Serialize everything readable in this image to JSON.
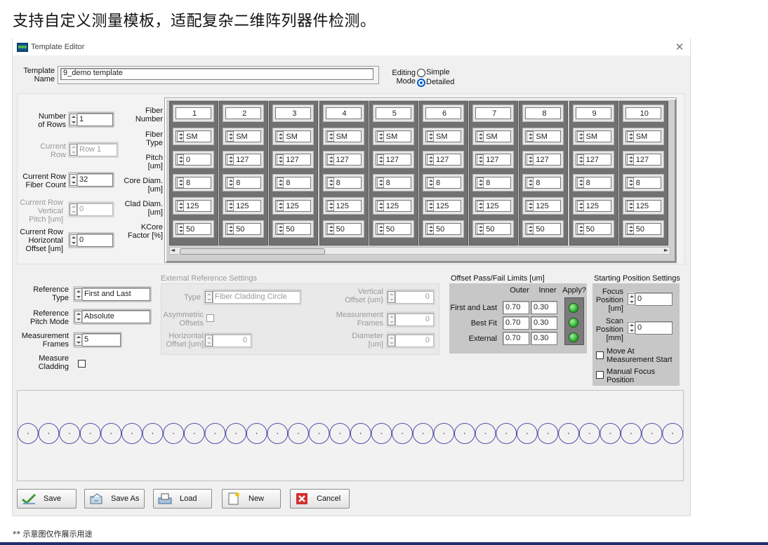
{
  "headline": "支持自定义测量模板，适配复杂二维阵列器件检测。",
  "window_title": "Template Editor",
  "close_glyph": "✕",
  "template_name": {
    "label": "Template\nName",
    "value": "9_demo template"
  },
  "editing_mode": {
    "label": "Editing\nMode",
    "options": [
      "Simple",
      "Detailed"
    ],
    "selected": "Detailed"
  },
  "left_params": {
    "number_of_rows": {
      "label": "Number\nof Rows",
      "value": "1"
    },
    "current_row": {
      "label": "Current\nRow",
      "value": "Row 1"
    },
    "current_row_fiber_count": {
      "label": "Current Row\nFiber Count",
      "value": "32"
    },
    "current_row_vertical_pitch": {
      "label": "Current Row\nVertical\nPitch [um]",
      "value": "0"
    },
    "current_row_horizontal_offset": {
      "label": "Current Row\nHorizontal\nOffset [um]",
      "value": "0"
    }
  },
  "grid": {
    "row_labels": [
      "Fiber\nNumber",
      "Fiber\nType",
      "Pitch\n[um]",
      "Core Diam.\n[um]",
      "Clad Diam.\n[um]",
      "KCore\nFactor [%]"
    ],
    "fiber_numbers": [
      "1",
      "2",
      "3",
      "4",
      "5",
      "6",
      "7",
      "8",
      "9",
      "10"
    ],
    "fiber_types": [
      "SM",
      "SM",
      "SM",
      "SM",
      "SM",
      "SM",
      "SM",
      "SM",
      "SM",
      "SM"
    ],
    "pitch": [
      "0",
      "127",
      "127",
      "127",
      "127",
      "127",
      "127",
      "127",
      "127",
      "127"
    ],
    "core_diam": [
      "8",
      "8",
      "8",
      "8",
      "8",
      "8",
      "8",
      "8",
      "8",
      "8"
    ],
    "clad_diam": [
      "125",
      "125",
      "125",
      "125",
      "125",
      "125",
      "125",
      "125",
      "125",
      "125"
    ],
    "kcore_factor": [
      "50",
      "50",
      "50",
      "50",
      "50",
      "50",
      "50",
      "50",
      "50",
      "50"
    ],
    "scroll_left_arrow": "◄",
    "scroll_right_arrow": "►"
  },
  "reference": {
    "type": {
      "label": "Reference\nType",
      "value": "First and Last"
    },
    "pitch_mode": {
      "label": "Reference\nPitch Mode",
      "value": "Absolute"
    },
    "measurement_frames": {
      "label": "Measurement\nFrames",
      "value": "5"
    },
    "measure_cladding": {
      "label": "Measure\nCladding",
      "checked": false
    }
  },
  "external_reference": {
    "title": "External Reference Settings",
    "type": {
      "label": "Type",
      "value": "Fiber Cladding Circle"
    },
    "asymmetric_offsets": {
      "label": "Asymmetric\nOffsets",
      "checked": false
    },
    "horizontal_offset": {
      "label": "Horizontal\nOffset [um]",
      "value": "0"
    },
    "vertical_offset": {
      "label": "Vertical\nOffset (um)",
      "value": "0"
    },
    "measurement_frames": {
      "label": "Measurement\nFrames",
      "value": "0"
    },
    "diameter": {
      "label": "Diameter\n[um]",
      "value": "0"
    }
  },
  "offset_limits": {
    "title": "Offset Pass/Fail Limits [um]",
    "headers": [
      "Outer",
      "Inner",
      "Apply?"
    ],
    "rows": [
      {
        "label": "First and Last",
        "outer": "0.70",
        "inner": "0.30",
        "apply": true
      },
      {
        "label": "Best Fit",
        "outer": "0.70",
        "inner": "0.30",
        "apply": true
      },
      {
        "label": "External",
        "outer": "0.70",
        "inner": "0.30",
        "apply": true
      }
    ],
    "led_color": "#1ea61e"
  },
  "starting_position": {
    "title": "Starting Position Settings",
    "focus_position": {
      "label": "Focus\nPosition\n[um]",
      "value": "0"
    },
    "scan_position": {
      "label": "Scan\nPosition\n[mm]",
      "value": "0"
    },
    "move_at_start": {
      "label": "Move At\nMeasurement Start",
      "checked": false
    },
    "manual_focus": {
      "label": "Manual Focus\nPosition",
      "checked": false
    }
  },
  "preview": {
    "fiber_count": 32,
    "circle_color": "#3a3aa0"
  },
  "buttons": {
    "save": "Save",
    "save_as": "Save As",
    "load": "Load",
    "new": "New",
    "cancel": "Cancel"
  },
  "footnote": "** 示意图仅作展示用途"
}
